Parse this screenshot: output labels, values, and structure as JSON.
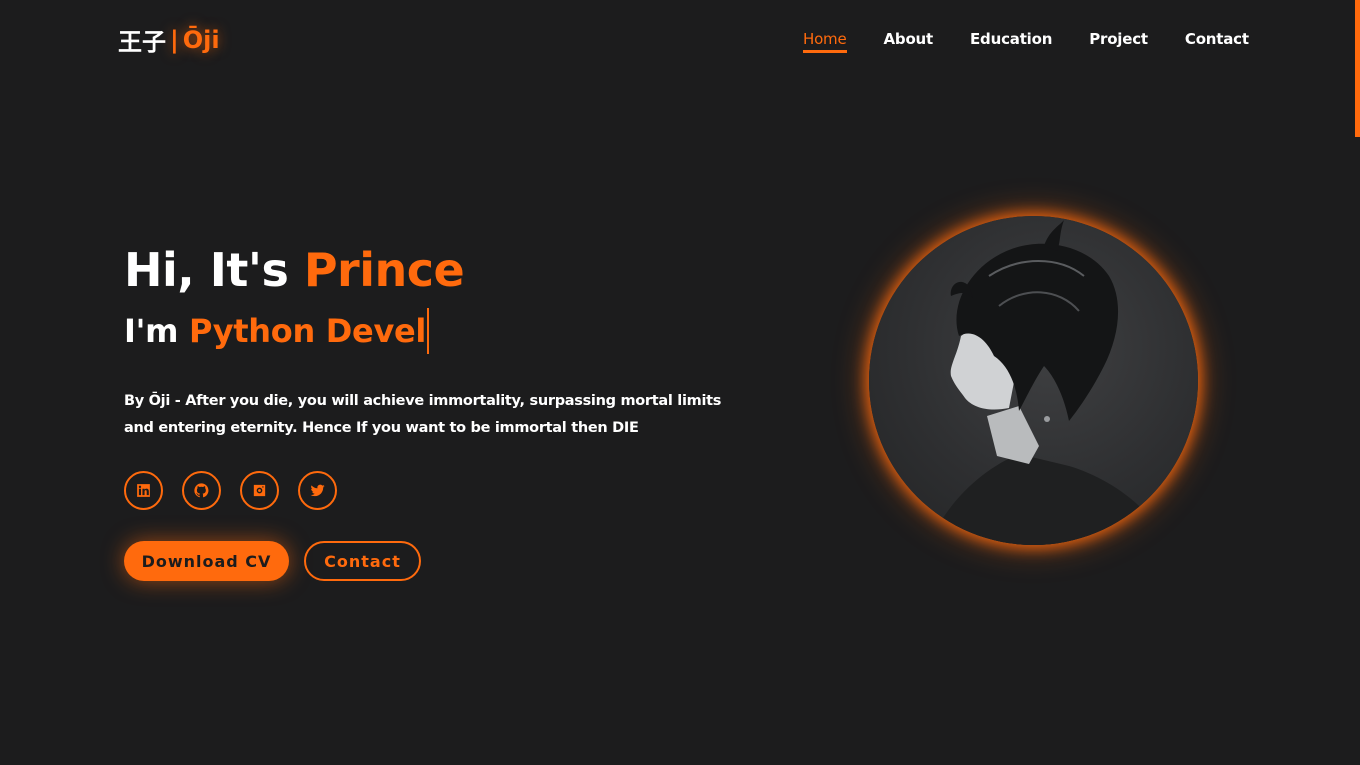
{
  "header": {
    "logo_kanji": "王子",
    "logo_separator": "|",
    "logo_name": "Ōji",
    "nav": [
      {
        "label": "Home",
        "active": true
      },
      {
        "label": "About",
        "active": false
      },
      {
        "label": "Education",
        "active": false
      },
      {
        "label": "Project",
        "active": false
      },
      {
        "label": "Contact",
        "active": false
      }
    ]
  },
  "hero": {
    "greeting": "Hi, It's ",
    "name": "Prince",
    "role_prefix": "I'm ",
    "role_typed": "Python Devel",
    "tagline": "By Ōji - After you die, you will achieve immortality, surpassing mortal limits and entering eternity. Hence If you want to be immortal then DIE",
    "socials": [
      {
        "icon": "linkedin-icon"
      },
      {
        "icon": "github-icon"
      },
      {
        "icon": "instagram-icon"
      },
      {
        "icon": "twitter-icon"
      }
    ],
    "buttons": {
      "download_cv": "Download CV",
      "contact": "Contact"
    }
  },
  "colors": {
    "background": "#1c1c1d",
    "accent": "#ff6a0d",
    "text": "#ffffff"
  }
}
